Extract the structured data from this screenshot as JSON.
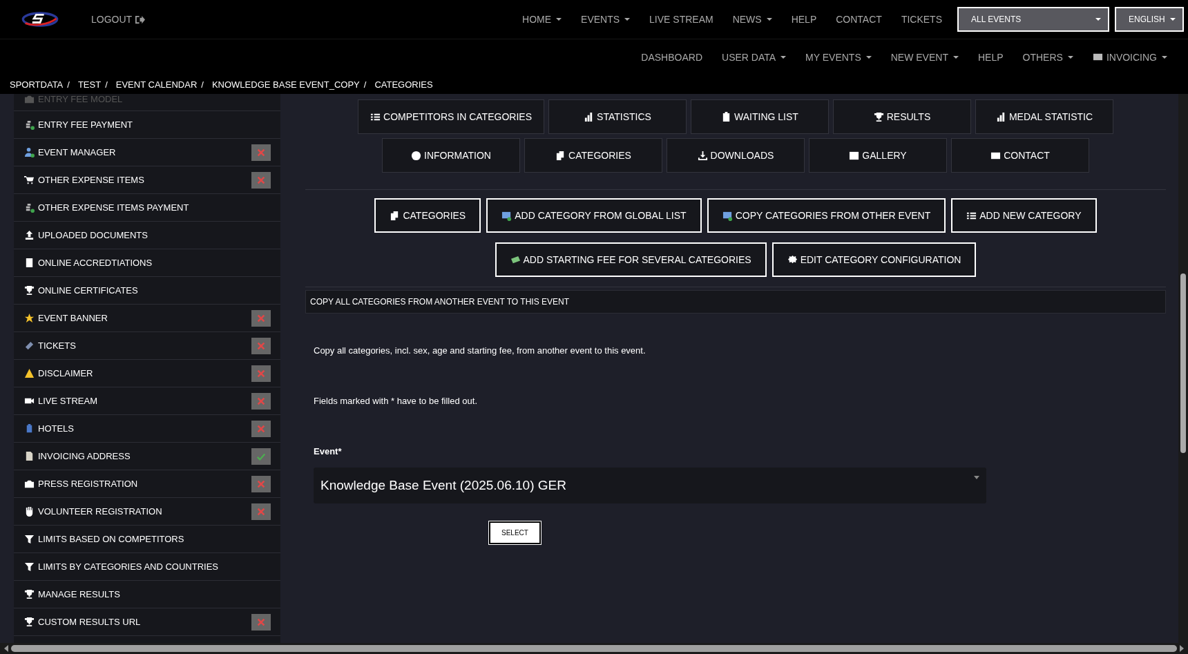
{
  "header": {
    "logout": "LOGOUT",
    "main_nav": [
      {
        "label": "HOME",
        "dropdown": true
      },
      {
        "label": "EVENTS",
        "dropdown": true
      },
      {
        "label": "LIVE STREAM",
        "dropdown": false
      },
      {
        "label": "NEWS",
        "dropdown": true
      },
      {
        "label": "HELP",
        "dropdown": false
      },
      {
        "label": "CONTACT",
        "dropdown": false
      },
      {
        "label": "TICKETS",
        "dropdown": false
      }
    ],
    "event_select": "ALL EVENTS",
    "language_select": "ENGLISH",
    "sub_nav": [
      {
        "label": "DASHBOARD",
        "dropdown": false
      },
      {
        "label": "USER DATA",
        "dropdown": true
      },
      {
        "label": "MY EVENTS",
        "dropdown": true
      },
      {
        "label": "NEW EVENT",
        "dropdown": true
      },
      {
        "label": "HELP",
        "dropdown": false
      },
      {
        "label": "OTHERS",
        "dropdown": true
      },
      {
        "label": "INVOICING",
        "dropdown": true
      }
    ]
  },
  "breadcrumb": {
    "separator": "/",
    "items": [
      "SPORTDATA",
      "TEST",
      "EVENT CALENDAR",
      "KNOWLEDGE BASE EVENT_COPY",
      "CATEGORIES"
    ]
  },
  "sidebar": {
    "items": [
      {
        "label": "ENTRY FEE MODEL",
        "dimmed": true
      },
      {
        "label": "ENTRY FEE PAYMENT",
        "dimmed": false
      },
      {
        "label": "EVENT MANAGER",
        "dimmed": false,
        "done": false
      },
      {
        "label": "OTHER EXPENSE ITEMS",
        "dimmed": false,
        "done": false
      },
      {
        "label": "OTHER EXPENSE ITEMS PAYMENT",
        "dimmed": false
      },
      {
        "label": "UPLOADED DOCUMENTS",
        "dimmed": false
      },
      {
        "label": "ONLINE ACCREDTIATIONS",
        "dimmed": false
      },
      {
        "label": "ONLINE CERTIFICATES",
        "dimmed": false
      },
      {
        "label": "EVENT BANNER",
        "dimmed": false,
        "done": false
      },
      {
        "label": "TICKETS",
        "dimmed": false,
        "done": false
      },
      {
        "label": "DISCLAIMER",
        "dimmed": false,
        "done": false
      },
      {
        "label": "LIVE STREAM",
        "dimmed": false,
        "done": false
      },
      {
        "label": "HOTELS",
        "dimmed": false,
        "done": false
      },
      {
        "label": "INVOICING ADDRESS",
        "dimmed": false,
        "done": true
      },
      {
        "label": "PRESS REGISTRATION",
        "dimmed": false,
        "done": false
      },
      {
        "label": "VOLUNTEER REGISTRATION",
        "dimmed": false,
        "done": false
      },
      {
        "label": "LIMITS BASED ON COMPETITORS",
        "dimmed": false
      },
      {
        "label": "LIMITS BY CATEGORIES AND COUNTRIES",
        "dimmed": false
      },
      {
        "label": "MANAGE RESULTS",
        "dimmed": false
      },
      {
        "label": "CUSTOM RESULTS URL",
        "dimmed": false,
        "done": false
      }
    ]
  },
  "event_nav": {
    "rows": [
      [
        "COMPETITORS IN CATEGORIES",
        "STATISTICS",
        "WAITING LIST",
        "RESULTS",
        "MEDAL STATISTIC"
      ],
      [
        "INFORMATION",
        "CATEGORIES",
        "DOWNLOADS",
        "GALLERY",
        "CONTACT"
      ]
    ]
  },
  "category_actions": {
    "buttons": [
      "CATEGORIES",
      "ADD CATEGORY FROM GLOBAL LIST",
      "COPY CATEGORIES FROM OTHER EVENT",
      "ADD NEW CATEGORY",
      "ADD STARTING FEE FOR SEVERAL CATEGORIES",
      "EDIT CATEGORY CONFIGURATION"
    ]
  },
  "copy_panel": {
    "title": "COPY ALL CATEGORIES FROM ANOTHER EVENT TO THIS EVENT",
    "description": "Copy all categories, incl. sex, age and starting fee, from another event to this event.",
    "required_note": "Fields marked with * have to be filled out.",
    "field": {
      "label": "Event*",
      "value": "Knowledge Base Event (2025.06.10) GER"
    },
    "submit": "SELECT"
  }
}
